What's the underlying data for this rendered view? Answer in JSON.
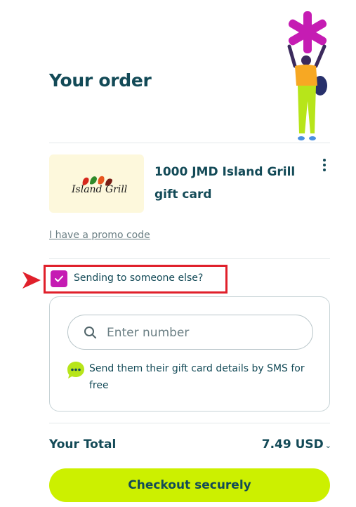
{
  "header": {
    "title": "Your order"
  },
  "product": {
    "name": "1000 JMD Island Grill gift card",
    "logo_text": "Island Grill"
  },
  "promo": {
    "link_label": "I have a promo code"
  },
  "recipient": {
    "checkbox_label": "Sending to someone else?",
    "checked": true
  },
  "sms": {
    "placeholder": "Enter number",
    "info_text": "Send them their gift card details by SMS for free"
  },
  "total": {
    "label": "Your Total",
    "amount": "7.49 USD"
  },
  "checkout": {
    "button_label": "Checkout securely"
  },
  "colors": {
    "text_primary": "#134a57",
    "checkbox_accent": "#c51cb3",
    "cta_background": "#ccf000",
    "highlight_border": "#e0202b",
    "thumb_background": "#fdf8dc"
  }
}
